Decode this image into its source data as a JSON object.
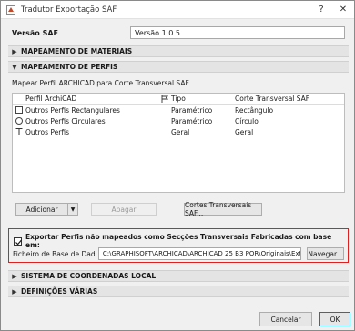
{
  "window": {
    "title": "Tradutor Exportação SAF",
    "help_glyph": "?",
    "close_glyph": "✕"
  },
  "version": {
    "label": "Versão SAF",
    "value": "Versão 1.0.5"
  },
  "sections": {
    "materiais": "MAPEAMENTO DE MATERIAIS",
    "perfis": "MAPEAMENTO DE PERFIS",
    "coordenadas": "SISTEMA DE COORDENADAS LOCAL",
    "definicoes": "DEFINIÇÕES VÁRIAS"
  },
  "perfis": {
    "description": "Mapear Perfil ARCHICAD para Corte Transversal SAF",
    "columns": {
      "perfil": "Perfil ArchiCAD",
      "tipo": "Tipo",
      "corte": "Corte Transversal SAF"
    },
    "rows": [
      {
        "icon": "square-outline-icon",
        "perfil": "Outros Perfis Rectangulares",
        "tipo": "Paramétrico",
        "corte": "Rectângulo"
      },
      {
        "icon": "circle-outline-icon",
        "perfil": "Outros Perfis Circulares",
        "tipo": "Paramétrico",
        "corte": "Círculo"
      },
      {
        "icon": "i-beam-icon",
        "perfil": "Outros Perfis",
        "tipo": "Geral",
        "corte": "Geral"
      }
    ]
  },
  "buttons": {
    "adicionar": "Adicionar",
    "dropdown": "▼",
    "apagar": "Apagar",
    "cortes": "Cortes Transversais SAF...",
    "navegar": "Navegar...",
    "cancelar": "Cancelar",
    "ok": "OK"
  },
  "export": {
    "checked": true,
    "label": "Exportar Perfis não mapeados como Secções Transversais Fabricadas com base em:",
    "file_label": "Ficheiro de Base de Dad",
    "path": "C:\\GRAPHISOFT\\ARCHICAD\\ARCHICAD 25 B3 POR\\Originais\\External"
  },
  "colors": {
    "highlight_border": "#e02020",
    "default_button_border": "#0078d7"
  }
}
